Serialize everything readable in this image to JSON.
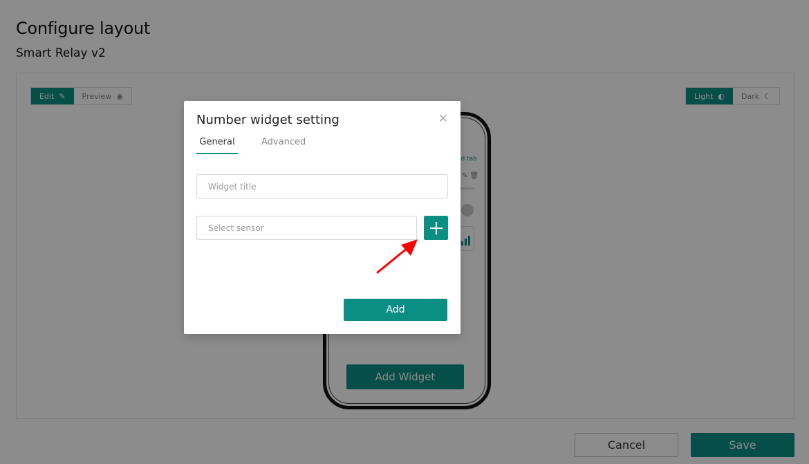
{
  "page": {
    "title": "Configure layout",
    "subtitle": "Smart Relay v2"
  },
  "mode_toggle": {
    "edit_label": "Edit",
    "edit_icon": "pencil-icon",
    "preview_label": "Preview",
    "preview_icon": "eye-icon",
    "active": "Edit"
  },
  "theme_toggle": {
    "light_label": "Light",
    "light_icon": "contrast-icon",
    "dark_label": "Dark",
    "dark_icon": "moon-icon",
    "active": "Light"
  },
  "phone": {
    "add_tab_label": "ld tab",
    "add_widget_label": "Add Widget"
  },
  "footer": {
    "cancel_label": "Cancel",
    "save_label": "Save"
  },
  "modal": {
    "title": "Number widget setting",
    "close_icon": "close-icon",
    "tabs": [
      {
        "label": "General",
        "active": true
      },
      {
        "label": "Advanced",
        "active": false
      }
    ],
    "widget_title": {
      "value": "",
      "placeholder": "Widget title"
    },
    "sensor": {
      "value": "",
      "placeholder": "Select sensor"
    },
    "add_sensor_icon": "plus-icon",
    "annotation_icon": "red-arrow-icon",
    "add_label": "Add"
  },
  "colors": {
    "accent": "#0b8f84",
    "annotation": "#ff0000"
  }
}
